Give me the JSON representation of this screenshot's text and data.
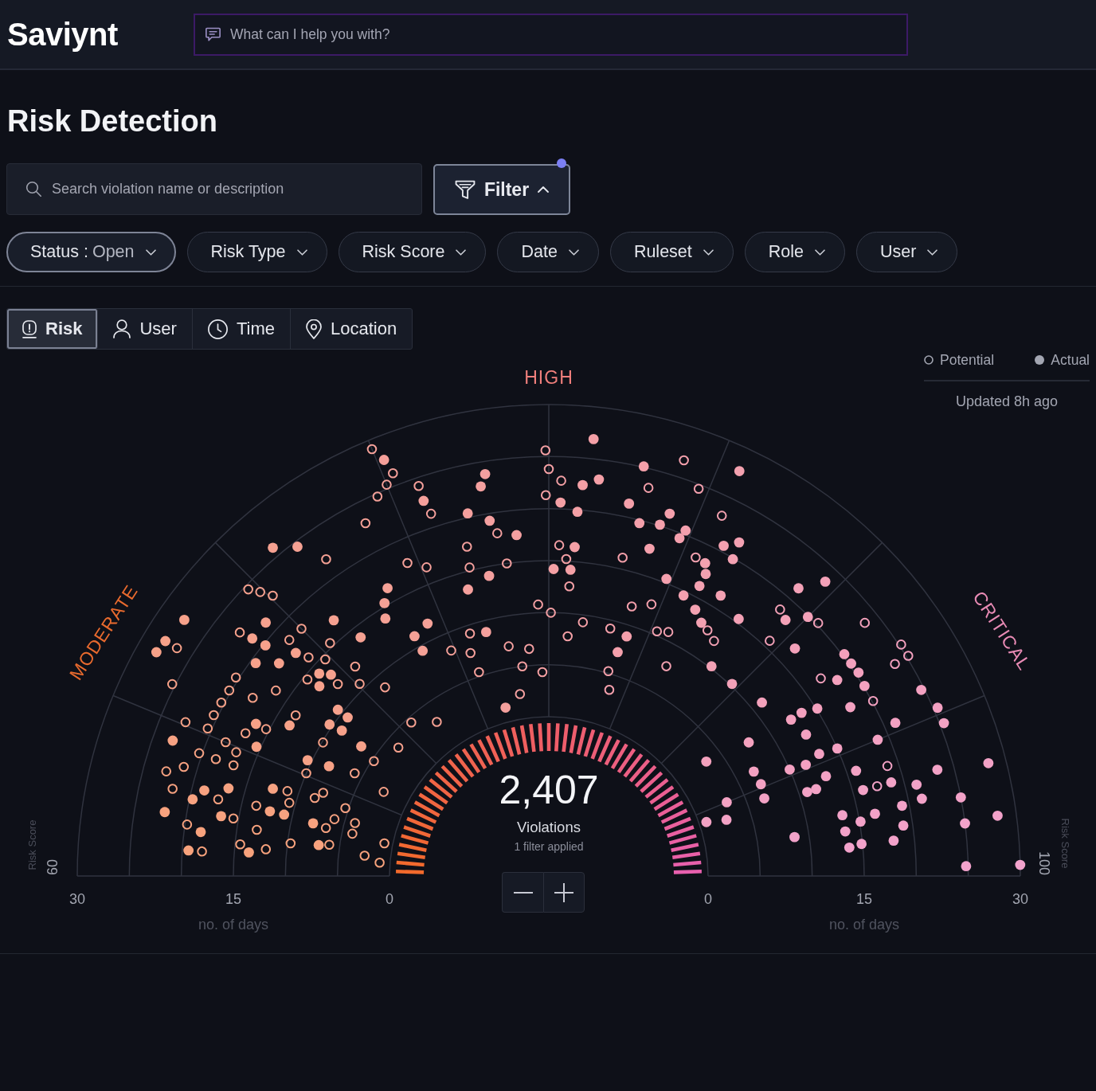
{
  "header": {
    "logo": "Saviynt",
    "assistant": {
      "placeholder": "What can I help you with?"
    }
  },
  "page": {
    "title": "Risk Detection"
  },
  "search": {
    "placeholder": "Search violation name or description"
  },
  "filter_button": {
    "label": "Filter",
    "expanded": true,
    "active": true
  },
  "filters": [
    {
      "label": "Status :",
      "value": "Open",
      "applied": true
    },
    {
      "label": "Risk Type",
      "applied": false
    },
    {
      "label": "Risk Score",
      "applied": false
    },
    {
      "label": "Date",
      "applied": false
    },
    {
      "label": "Ruleset",
      "applied": false
    },
    {
      "label": "Role",
      "applied": false
    },
    {
      "label": "User",
      "applied": false
    }
  ],
  "view_tabs": [
    {
      "label": "Risk",
      "selected": true
    },
    {
      "label": "User",
      "selected": false
    },
    {
      "label": "Time",
      "selected": false
    },
    {
      "label": "Location",
      "selected": false
    }
  ],
  "chart": {
    "legend": [
      {
        "label": "Potential"
      },
      {
        "label": "Actual"
      }
    ],
    "updated": "Updated 8h ago",
    "zones": [
      {
        "label": "MODERATE",
        "color": "#e86a2e"
      },
      {
        "label": "HIGH",
        "color": "#f07f7c"
      },
      {
        "label": "CRITICAL",
        "color": "#e98bb5"
      }
    ],
    "total": "2,407",
    "total_label": "Violations",
    "filters_note": "1 filter applied",
    "left_axis": {
      "score_label": "Risk Score",
      "score_tick": "60",
      "ticks": [
        "30",
        "15",
        "0"
      ],
      "label": "no. of days"
    },
    "right_axis": {
      "ticks": [
        "0",
        "15",
        "30"
      ],
      "label": "no. of days",
      "score_tick": "100",
      "score_label": "Risk Score"
    }
  }
}
